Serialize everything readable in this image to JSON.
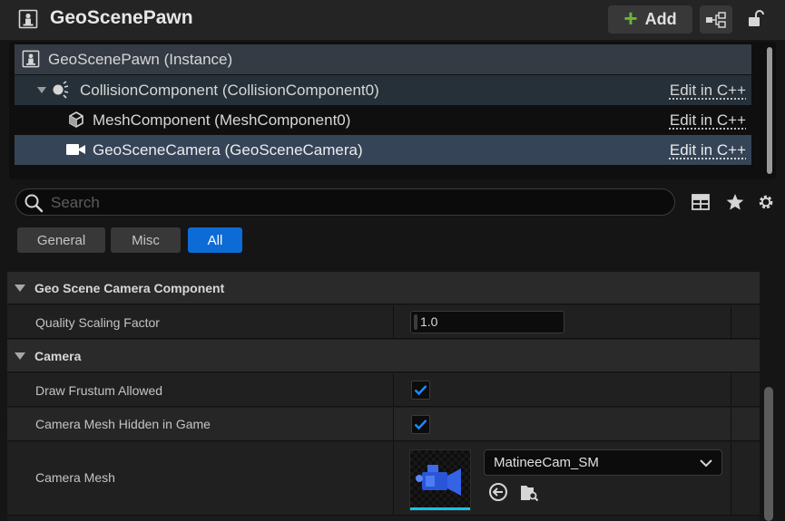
{
  "header": {
    "title": "GeoScenePawn",
    "add_label": "Add"
  },
  "tree": {
    "rows": [
      {
        "label": "GeoScenePawn (Instance)",
        "edit": ""
      },
      {
        "label": "CollisionComponent (CollisionComponent0)",
        "edit": "Edit in C++"
      },
      {
        "label": "MeshComponent (MeshComponent0)",
        "edit": "Edit in C++"
      },
      {
        "label": "GeoSceneCamera (GeoSceneCamera)",
        "edit": "Edit in C++"
      }
    ]
  },
  "search": {
    "placeholder": "Search",
    "value": ""
  },
  "filters": {
    "tabs": [
      "General",
      "Misc",
      "All"
    ],
    "active": "All"
  },
  "details": {
    "categories": [
      {
        "label": "Geo Scene Camera Component"
      },
      {
        "label": "Camera"
      }
    ],
    "props": {
      "quality_scaling_factor": {
        "label": "Quality Scaling Factor",
        "value": "1.0"
      },
      "draw_frustum_allowed": {
        "label": "Draw Frustum Allowed",
        "checked": true
      },
      "camera_mesh_hidden": {
        "label": "Camera Mesh Hidden in Game",
        "checked": true
      },
      "camera_mesh": {
        "label": "Camera Mesh",
        "asset": "MatineeCam_SM"
      }
    }
  },
  "colors": {
    "accent": "#0d6bd6",
    "add_plus": "#6ab637",
    "check": "#1e8cff",
    "selected_row": "#354457"
  }
}
